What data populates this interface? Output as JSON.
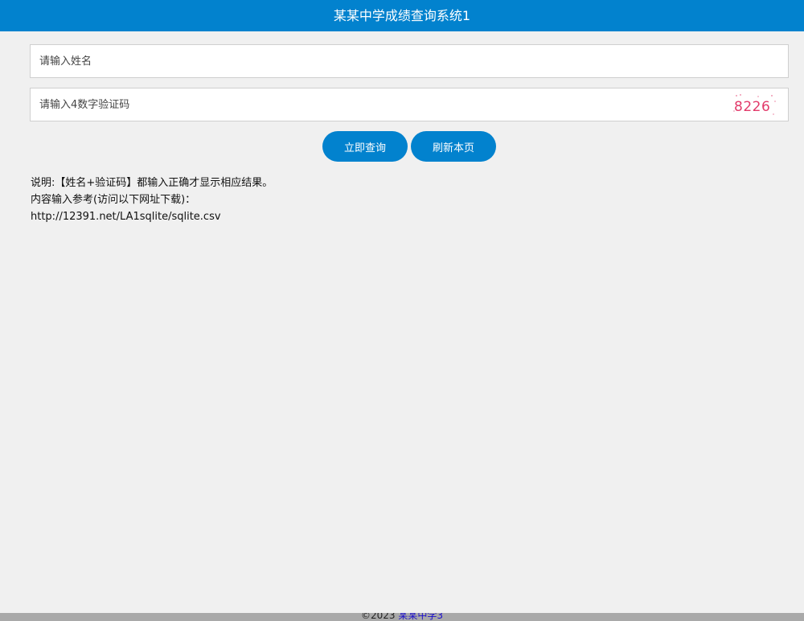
{
  "header": {
    "title": "某某中学成绩查询系统1"
  },
  "form": {
    "name_placeholder": "请输入姓名",
    "code_placeholder": "请输入4数字验证码",
    "captcha_text": "8226",
    "captcha_color": "#e23a6a"
  },
  "buttons": {
    "query_label": "立即查询",
    "refresh_label": "刷新本页"
  },
  "notes": {
    "line1": "说明:【姓名+验证码】都输入正确才显示相应结果。",
    "line2": "内容输入参考(访问以下网址下载)：",
    "line3": "http://12391.net/LA1sqlite/sqlite.csv"
  },
  "footer": {
    "copyright": "©2023",
    "link_text": "某某中学3"
  },
  "colors": {
    "accent": "#0282ce",
    "background": "#f0f0f0",
    "footer_bar": "#a9a9a9"
  }
}
